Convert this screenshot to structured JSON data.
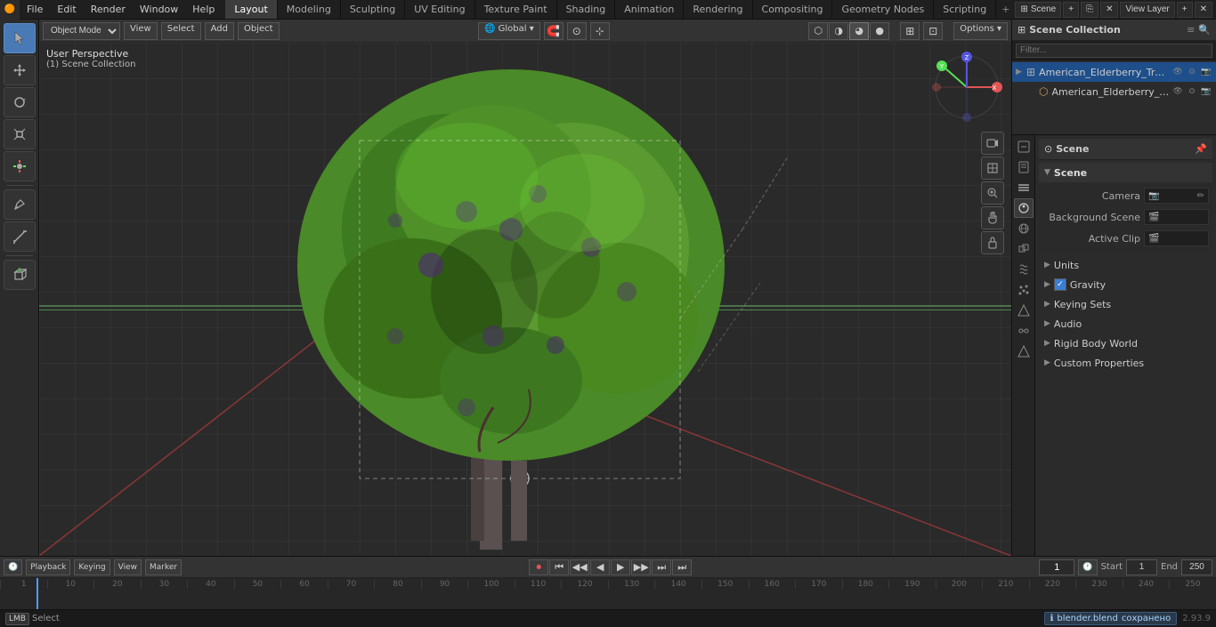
{
  "topBar": {
    "logoText": "🟠",
    "menuItems": [
      "File",
      "Edit",
      "Render",
      "Window",
      "Help"
    ],
    "workspaceTabs": [
      "Layout",
      "Modeling",
      "Sculpting",
      "UV Editing",
      "Texture Paint",
      "Shading",
      "Animation",
      "Rendering",
      "Compositing",
      "Geometry Nodes",
      "Scripting"
    ],
    "activeTab": "Layout",
    "addTabBtn": "+",
    "sceneLabel": "Scene",
    "viewLayerLabel": "View Layer"
  },
  "viewportHeader": {
    "modeLabel": "Object Mode",
    "viewLabel": "View",
    "selectLabel": "Select",
    "addLabel": "Add",
    "objectLabel": "Object",
    "transformLabel": "Global",
    "snapLabel": "🧲",
    "proportionalLabel": "⊙",
    "cursorLabel": "⊹",
    "optionsLabel": "Options ▾"
  },
  "viewport": {
    "label": "User Perspective",
    "subLabel": "(1) Scene Collection"
  },
  "outliner": {
    "title": "Scene Collection",
    "searchPlaceholder": "Filter...",
    "items": [
      {
        "name": "American_Elderberry_Tree_w",
        "icon": "▶",
        "indentLevel": 0,
        "hasArrow": true,
        "controls": [
          "👁",
          "📷",
          "⊙"
        ]
      },
      {
        "name": "American_Elderberry_Tre",
        "icon": "▶",
        "indentLevel": 1,
        "hasArrow": false,
        "controls": [
          "👁",
          "📷",
          "⊙"
        ]
      }
    ]
  },
  "propertiesTabs": [
    {
      "id": "render",
      "icon": "📷",
      "active": false
    },
    {
      "id": "output",
      "icon": "📄",
      "active": false
    },
    {
      "id": "view-layer",
      "icon": "🔲",
      "active": false
    },
    {
      "id": "scene",
      "icon": "🎬",
      "active": true
    },
    {
      "id": "world",
      "icon": "🌐",
      "active": false
    },
    {
      "id": "object",
      "icon": "⊡",
      "active": false
    },
    {
      "id": "modifier",
      "icon": "🔧",
      "active": false
    },
    {
      "id": "particles",
      "icon": "✦",
      "active": false
    },
    {
      "id": "physics",
      "icon": "⚡",
      "active": false
    },
    {
      "id": "constraints",
      "icon": "🔗",
      "active": false
    },
    {
      "id": "data",
      "icon": "△",
      "active": false
    }
  ],
  "propertiesPanel": {
    "headerTitle": "Scene",
    "sections": {
      "scene": {
        "label": "Scene",
        "expanded": true,
        "cameraLabel": "Camera",
        "cameraValue": "",
        "backgroundSceneLabel": "Background Scene",
        "backgroundSceneIcon": "🎬",
        "activeClipLabel": "Active Clip",
        "activeClipIcon": "🎬"
      },
      "units": {
        "label": "Units",
        "expanded": false
      },
      "gravity": {
        "label": "Gravity",
        "checked": true
      },
      "keyingSets": {
        "label": "Keying Sets",
        "expanded": false
      },
      "audio": {
        "label": "Audio",
        "expanded": false
      },
      "rigidBodyWorld": {
        "label": "Rigid Body World",
        "expanded": false
      },
      "customProperties": {
        "label": "Custom Properties",
        "expanded": false
      }
    }
  },
  "timeline": {
    "playbackLabel": "Playback",
    "keyingLabel": "Keying",
    "viewLabel": "View",
    "markerLabel": "Marker",
    "recordBtn": "⏺",
    "firstFrameBtn": "⏮",
    "prevKeyBtn": "◀◀",
    "prevFrameBtn": "◀",
    "playBtn": "▶",
    "nextFrameBtn": "▶▶",
    "nextKeyBtn": "▶▶",
    "lastFrameBtn": "⏭",
    "currentFrame": "1",
    "clockIcon": "🕐",
    "startLabel": "Start",
    "startValue": "1",
    "endLabel": "End",
    "endValue": "250",
    "frameNumbers": [
      "1",
      "10",
      "20",
      "30",
      "40",
      "50",
      "60",
      "70",
      "80",
      "90",
      "100",
      "110",
      "120",
      "130",
      "140",
      "150",
      "160",
      "170",
      "180",
      "190",
      "200",
      "210",
      "220",
      "230",
      "240",
      "250"
    ]
  },
  "statusBar": {
    "selectKey": "LMB",
    "selectLabel": "Select",
    "file": "blender.blend",
    "savedLabel": "сохранено",
    "version": "2.93.9"
  },
  "icons": {
    "arrow_right": "▶",
    "arrow_down": "▼",
    "scene": "⊞",
    "camera": "📷",
    "eye": "👁",
    "cursor": "⊕",
    "move": "↔",
    "rotate": "↺",
    "scale": "⊡",
    "transform": "⊞",
    "measure": "📐",
    "annotate": "✏",
    "search": "🔍",
    "filter": "≡",
    "checkmark": "✓",
    "magnify": "🔍",
    "hand": "✋",
    "camera_view": "🎥",
    "box": "⬜"
  }
}
